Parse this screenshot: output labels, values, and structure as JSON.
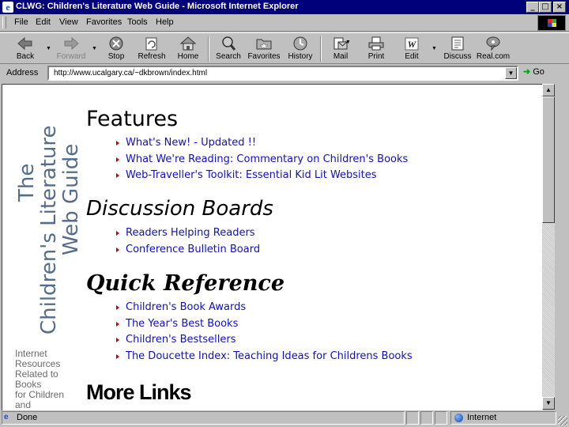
{
  "window": {
    "title": "CLWG: Children's Literature Web Guide - Microsoft Internet Explorer",
    "controls": {
      "minimize": "_",
      "maximize": "□",
      "close": "×"
    }
  },
  "menu": [
    {
      "label": "File",
      "icon": ""
    },
    {
      "label": "Edit"
    },
    {
      "label": "View"
    },
    {
      "label": "Favorites"
    },
    {
      "label": "Tools"
    },
    {
      "label": "Help"
    }
  ],
  "toolbar": {
    "back": "Back",
    "forward": "Forward",
    "stop": "Stop",
    "refresh": "Refresh",
    "home": "Home",
    "search": "Search",
    "favorites": "Favorites",
    "history": "History",
    "mail": "Mail",
    "print": "Print",
    "edit": "Edit",
    "discuss": "Discuss",
    "realcom": "Real.com"
  },
  "address": {
    "label": "Address",
    "url": "http://www.ucalgary.ca/~dkbrown/index.html",
    "go": "Go"
  },
  "page": {
    "logo_line1": "The",
    "logo_line2": "Children's Literature",
    "logo_line3": "Web Guide",
    "side_text": [
      "Internet",
      "Resources",
      "Related to",
      "Books",
      "for Children",
      "and"
    ],
    "sections": {
      "features": {
        "title": "Features",
        "links": [
          "What's New! - Updated !!",
          "What We're Reading: Commentary on Children's Books",
          "Web-Traveller's Toolkit: Essential Kid Lit Websites"
        ]
      },
      "discussion": {
        "title": "Discussion Boards",
        "links": [
          "Readers Helping Readers",
          "Conference Bulletin Board"
        ]
      },
      "quick": {
        "title": "Quick Reference",
        "links": [
          "Children's Book Awards",
          "The Year's Best Books",
          "Children's Bestsellers",
          "The Doucette Index: Teaching Ideas for Childrens Books"
        ]
      },
      "more": {
        "title": "More Links"
      }
    }
  },
  "status": {
    "text": "Done",
    "zone": "Internet"
  }
}
